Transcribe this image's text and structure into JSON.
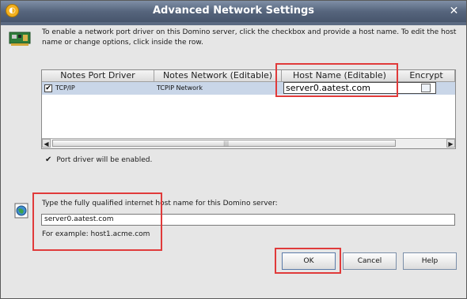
{
  "window": {
    "title": "Advanced Network Settings",
    "close_glyph": "✕"
  },
  "intro": {
    "text": "To enable a network port driver on this Domino server, click the checkbox and provide a host name. To edit the host name or change options, click inside the row."
  },
  "table": {
    "columns": [
      "Notes Port Driver",
      "Notes Network (Editable)",
      "Host Name (Editable)",
      "Encrypt"
    ],
    "rows": [
      {
        "enabled": true,
        "driver": "TCP/IP",
        "network": "TCPIP Network",
        "host": "server0.aatest.com",
        "encrypt": false
      }
    ]
  },
  "status": {
    "check_glyph": "✔",
    "text": "Port driver will be enabled."
  },
  "host_section": {
    "label": "Type the fully qualified internet host name for this Domino server:",
    "value": "server0.aatest.com",
    "example": "For example: host1.acme.com"
  },
  "buttons": {
    "ok": "OK",
    "cancel": "Cancel",
    "help": "Help"
  },
  "colors": {
    "title_bar": "#56657d",
    "highlight": "#e03a3a",
    "selected_row": "#c9d6e8"
  }
}
